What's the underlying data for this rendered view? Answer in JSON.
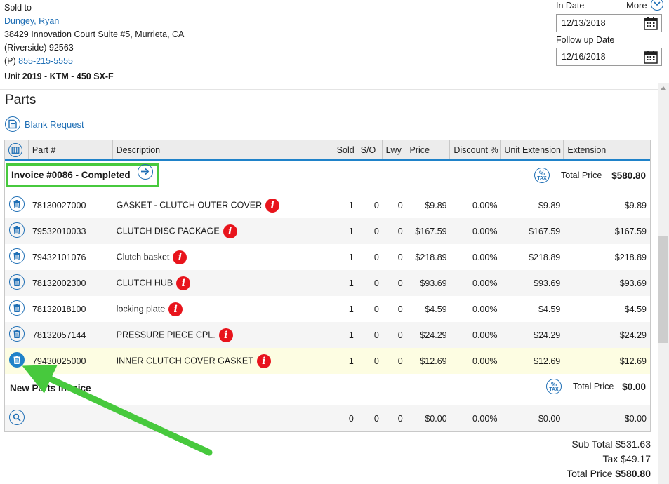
{
  "sold_to": {
    "label": "Sold to",
    "customer_name": "Dungey, Ryan",
    "address_line1": "38429 Innovation Court Suite #5, Murrieta, CA",
    "address_line2": "(Riverside) 92563",
    "phone_prefix": "(P)",
    "phone": "855-215-5555",
    "unit_label": "Unit",
    "unit_year": "2019",
    "unit_make": "KTM",
    "unit_model": "450 SX-F",
    "unit_sep": "-"
  },
  "dates": {
    "more_label": "More",
    "in_date_label": "In Date",
    "in_date_value": "12/13/2018",
    "follow_up_label": "Follow up Date",
    "follow_up_value": "12/16/2018"
  },
  "parts": {
    "title": "Parts",
    "blank_request_label": "Blank Request",
    "columns": [
      "Part #",
      "Description",
      "Sold",
      "S/O",
      "Lwy",
      "Price",
      "Discount %",
      "Unit Extension",
      "Extension"
    ],
    "invoice": {
      "title": "Invoice #0086 - Completed",
      "tax_icon_top": "%",
      "tax_icon_bottom": "TAX",
      "total_label": "Total Price",
      "total_value": "$580.80"
    },
    "rows": [
      {
        "part": "78130027000",
        "desc": "GASKET - CLUTCH OUTER COVER",
        "sold": "1",
        "so": "0",
        "lwy": "0",
        "price": "$9.89",
        "disc": "0.00%",
        "uext": "$9.89",
        "ext": "$9.89"
      },
      {
        "part": "79532010033",
        "desc": "CLUTCH DISC PACKAGE",
        "sold": "1",
        "so": "0",
        "lwy": "0",
        "price": "$167.59",
        "disc": "0.00%",
        "uext": "$167.59",
        "ext": "$167.59"
      },
      {
        "part": "79432101076",
        "desc": "Clutch basket",
        "sold": "1",
        "so": "0",
        "lwy": "0",
        "price": "$218.89",
        "disc": "0.00%",
        "uext": "$218.89",
        "ext": "$218.89"
      },
      {
        "part": "78132002300",
        "desc": "CLUTCH HUB",
        "sold": "1",
        "so": "0",
        "lwy": "0",
        "price": "$93.69",
        "disc": "0.00%",
        "uext": "$93.69",
        "ext": "$93.69"
      },
      {
        "part": "78132018100",
        "desc": "locking plate",
        "sold": "1",
        "so": "0",
        "lwy": "0",
        "price": "$4.59",
        "disc": "0.00%",
        "uext": "$4.59",
        "ext": "$4.59"
      },
      {
        "part": "78132057144",
        "desc": "PRESSURE PIECE CPL.",
        "sold": "1",
        "so": "0",
        "lwy": "0",
        "price": "$24.29",
        "disc": "0.00%",
        "uext": "$24.29",
        "ext": "$24.29"
      },
      {
        "part": "79430025000",
        "desc": "INNER CLUTCH COVER GASKET",
        "sold": "1",
        "so": "0",
        "lwy": "0",
        "price": "$12.69",
        "disc": "0.00%",
        "uext": "$12.69",
        "ext": "$12.69"
      }
    ],
    "info_icon_glyph": "i",
    "new_invoice": {
      "title": "New Parts Invoice",
      "total_label": "Total Price",
      "total_value": "$0.00",
      "row": {
        "sold": "0",
        "so": "0",
        "lwy": "0",
        "price": "$0.00",
        "disc": "0.00%",
        "uext": "$0.00",
        "ext": "$0.00"
      }
    }
  },
  "summary": {
    "sub_total_label": "Sub Total",
    "sub_total_value": "$531.63",
    "tax_label": "Tax",
    "tax_value": "$49.17",
    "total_label": "Total Price",
    "total_value": "$580.80"
  },
  "colors": {
    "accent": "#1f82c9",
    "link": "#1f6fb5",
    "highlight_box": "#47c93d",
    "info_icon": "#e8141c",
    "highlight_row": "#fdfde2"
  },
  "icons": [
    "calendar-icon",
    "chevron-down-icon",
    "blank-request-icon",
    "column-chooser-icon",
    "arrow-right-icon",
    "tax-icon",
    "trash-icon",
    "info-icon",
    "search-icon"
  ]
}
